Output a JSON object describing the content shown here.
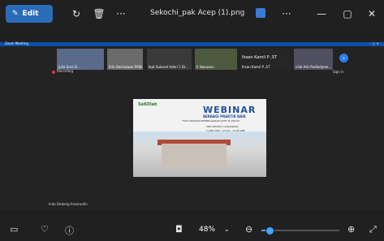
{
  "toolbar": {
    "edit_label": "Edit",
    "file_title": "Sekochi_pak Acep (1).png",
    "rotate_icon": "rotate-icon",
    "delete_icon": "trash-icon",
    "more_icon": "more-icon",
    "more2_icon": "more-icon",
    "minimize": "—",
    "maximize": "▢",
    "close": "✕"
  },
  "zoom_meeting": {
    "app_label": "Zoom Meeting",
    "participants": [
      "Julia Sera D...",
      "Erik Darmawan PAIN",
      "Ikpt Sukaret telkri 1 Di...",
      "Il Hanasan...",
      "Ihsan Kamil P ,ST",
      "nilal Ash Pudladyom..."
    ],
    "featured_name": "Ihsan Kamil P ,ST",
    "recording_label": "Recording",
    "signin_label": "Sign in",
    "speaker_label": "Indo Dedeng hasanudin"
  },
  "slide": {
    "logo": "SeKOlah",
    "title": "WEBINAR",
    "subtitle": "BERBAGI PRAKTIK BAIK",
    "line2": "\"IVM CIPTAKAN PEMBELAJARAN AKTIF DI KELAS\"",
    "line3": "SMK NEGERI 1 KARAWANG",
    "line4": "1 JUNI 2021 | 10.00 - 11.00 WIB"
  },
  "bottom": {
    "zoom_value": "48%",
    "zoom_fraction": 0.1
  },
  "colors": {
    "accent": "#2b6cb8",
    "zoom_blue": "#0b4fa8",
    "slider": "#4aa3ff"
  }
}
